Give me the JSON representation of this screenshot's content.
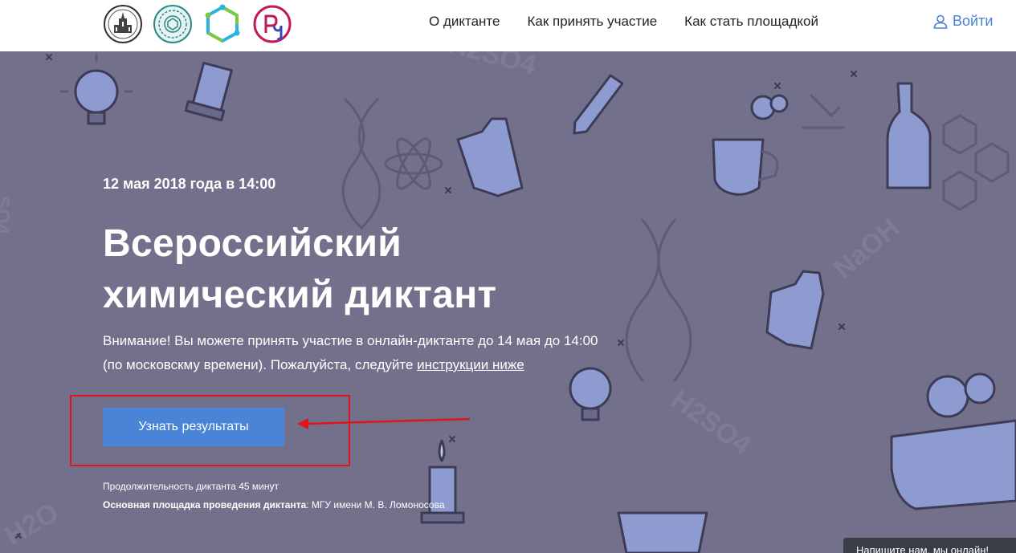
{
  "header": {
    "logos": [
      "msu-logo-icon",
      "chemistry-faculty-logo-icon",
      "hexagon-logo-icon",
      "ru-logo-icon"
    ],
    "nav": [
      "О диктанте",
      "Как принять участие",
      "Как стать площадкой"
    ],
    "login_label": "Войти"
  },
  "hero": {
    "date": "12 мая 2018 года в 14:00",
    "title_line1": "Всероссийский",
    "title_line2": "химический диктант",
    "notice_text": "Внимание! Вы можете принять участие в онлайн-диктанте до 14 мая до 14:00 (по московскму времени). Пожалуйста, следуйте ",
    "notice_link": "инструкции ниже",
    "button_label": "Узнать результаты",
    "duration": "Продолжительность диктанта 45 минут",
    "venue_label": "Основная площадка проведения диктанта",
    "venue_value": ": МГУ имени М. В. Ломоносова",
    "background_text": [
      "H2SO4",
      "NaOH",
      "H2SO4",
      "H2O",
      "SO4"
    ]
  },
  "chat_widget": {
    "label": "Напишите нам, мы онлайн!"
  },
  "colors": {
    "hero_bg": "#72708a",
    "accent": "#4a84d6",
    "highlight": "#e0151b"
  }
}
